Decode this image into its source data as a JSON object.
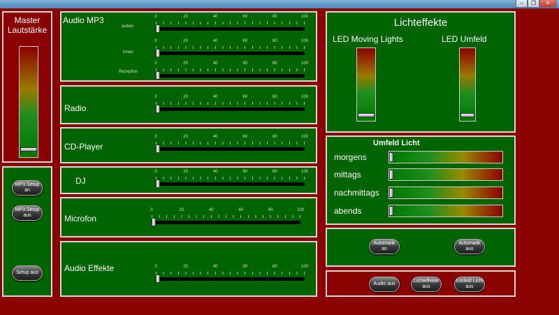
{
  "window": {
    "minimize": "–",
    "restore": "❐",
    "close": "✕"
  },
  "master": {
    "title_line1": "Master",
    "title_line2": "Lautstärke",
    "level": 0.05
  },
  "setup": {
    "mp3_setup_on": "MP3 Setup\nan",
    "mp3_setup_off": "MP3 Setup\naus",
    "setup_off": "Setup aus"
  },
  "ticks": [
    "0",
    "20",
    "40",
    "60",
    "80",
    "100"
  ],
  "audio_mp3": {
    "title": "Audio MP3",
    "sliders": [
      {
        "label": "außen",
        "value": 0
      },
      {
        "label": "innen",
        "value": 0
      },
      {
        "label": "Rezeption",
        "value": 0
      }
    ]
  },
  "radio": {
    "title": "Radio",
    "value": 0
  },
  "cd_player": {
    "title": "CD-Player",
    "value": 0
  },
  "dj": {
    "title": "DJ",
    "value": 0
  },
  "microfon": {
    "title": "Microfon",
    "value": 0
  },
  "audio_effekte": {
    "title": "Audio Effekte",
    "value": 0
  },
  "lichteffekte": {
    "title": "Lichteffekte",
    "moving_lights": {
      "label": "LED Moving Lights",
      "level": 0.05
    },
    "umfeld": {
      "label": "LED Umfeld",
      "level": 0.05
    }
  },
  "umfeld_licht": {
    "title": "Umfeld Licht",
    "rows": [
      {
        "label": "morgens",
        "value": 0
      },
      {
        "label": "mittags",
        "value": 0
      },
      {
        "label": "nachmittags",
        "value": 0
      },
      {
        "label": "abends",
        "value": 0
      }
    ]
  },
  "automatik": {
    "on": "Automatik\nan",
    "off": "Automatik\naus"
  },
  "bottom": {
    "audio_off": "Audio aus",
    "lichteffekte_off": "Lichteffekte\naus",
    "umfeld_off": "Umfeld Licht\naus"
  }
}
